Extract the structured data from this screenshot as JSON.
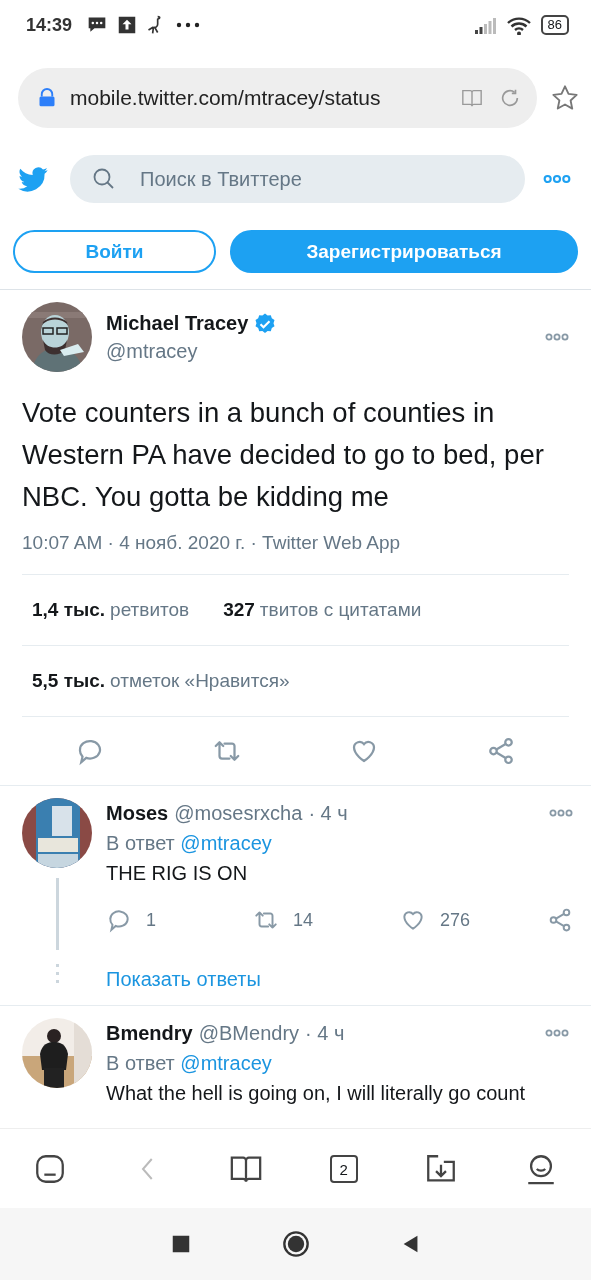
{
  "status_bar": {
    "time": "14:39",
    "battery": "86"
  },
  "browser": {
    "url": "mobile.twitter.com/mtracey/status"
  },
  "header": {
    "search": {
      "placeholder": "Поиск в Твиттере"
    }
  },
  "auth_buttons": [
    {
      "label": "Войти",
      "kind": "outline"
    },
    {
      "label": "Зарегистрироваться",
      "kind": "filled"
    }
  ],
  "tweet": {
    "name": "Michael Tracey",
    "verified": true,
    "handle": "@mtracey",
    "text": "Vote counters in a bunch of counties in Western PA have decided to go to bed, per NBC. You gotta be kidding me",
    "meta": "10:07 AM · 4 нояб. 2020 г. · Twitter Web App",
    "stats": [
      {
        "count": "1,4 тыс.",
        "caption": "ретвитов"
      },
      {
        "count": "327",
        "caption": "твитов с цитатами"
      }
    ],
    "likes": {
      "count": "5,5 тыс.",
      "caption": "отметок «Нравится»"
    }
  },
  "replies": [
    {
      "name": "Moses",
      "handle": "@mosesrxcha",
      "time": "· 4 ч",
      "reply_prefix": "В ответ",
      "reply_to": "@mtracey",
      "text": "THE RIG IS ON",
      "counts": {
        "replies": "1",
        "retweets": "14",
        "likes": "276"
      },
      "show_replies": "Показать ответы"
    },
    {
      "name": "Bmendry",
      "handle": "@BMendry",
      "time": "· 4 ч",
      "reply_prefix": "В ответ",
      "reply_to": "@mtracey",
      "text": "What the hell is going on, I will literally go count"
    }
  ],
  "bottom_nav": {
    "tab_count": "2"
  }
}
